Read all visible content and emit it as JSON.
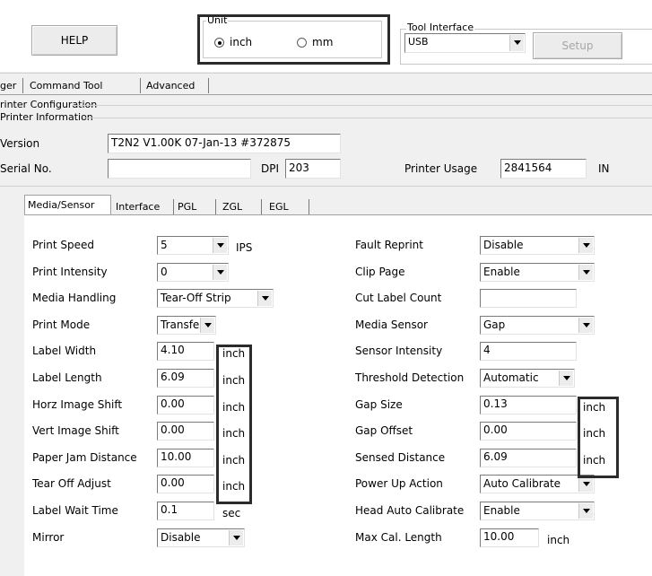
{
  "toolbar": {
    "help_label": "HELP",
    "setup_label": "Setup"
  },
  "unit": {
    "group_label": "Unit",
    "option_inch": "inch",
    "option_mm": "mm",
    "selected": "inch"
  },
  "tool_interface": {
    "group_label": "Tool Interface",
    "value": "USB"
  },
  "main_tabs": [
    "ger",
    "Command Tool",
    "Advanced"
  ],
  "printer_configuration": {
    "label": "rinter Configuration",
    "info_label": "Printer Information",
    "version_label": "Version",
    "version_value": "T2N2 V1.00K 07-Jan-13 #372875",
    "serial_label": "Serial No.",
    "serial_value": "",
    "dpi_label": "DPI",
    "dpi_value": "203",
    "usage_label": "Printer Usage",
    "usage_value": "2841564",
    "usage_unit": "IN"
  },
  "sub_tabs": [
    "Media/Sensor",
    "Interface",
    "PGL",
    "ZGL",
    "EGL"
  ],
  "left_settings": [
    {
      "label": "Print Speed",
      "value": "5",
      "kind": "combo",
      "unit": "IPS"
    },
    {
      "label": "Print Intensity",
      "value": "0",
      "kind": "combo",
      "unit": ""
    },
    {
      "label": "Media Handling",
      "value": "Tear-Off Strip",
      "kind": "combo",
      "unit": ""
    },
    {
      "label": "Print Mode",
      "value": "Transfer",
      "kind": "combo",
      "unit": ""
    },
    {
      "label": "Label Width",
      "value": "4.10",
      "kind": "field",
      "unit": "inch"
    },
    {
      "label": "Label Length",
      "value": "6.09",
      "kind": "field",
      "unit": "inch"
    },
    {
      "label": "Horz Image Shift",
      "value": "0.00",
      "kind": "field",
      "unit": "inch"
    },
    {
      "label": "Vert Image Shift",
      "value": "0.00",
      "kind": "field",
      "unit": "inch"
    },
    {
      "label": "Paper Jam Distance",
      "value": "10.00",
      "kind": "field",
      "unit": "inch"
    },
    {
      "label": "Tear Off Adjust",
      "value": "0.00",
      "kind": "field",
      "unit": "inch"
    },
    {
      "label": "Label Wait Time",
      "value": "0.1",
      "kind": "field",
      "unit": "sec"
    },
    {
      "label": "Mirror",
      "value": "Disable",
      "kind": "combo",
      "unit": ""
    }
  ],
  "right_settings": [
    {
      "label": "Fault Reprint",
      "value": "Disable",
      "kind": "combo",
      "unit": ""
    },
    {
      "label": "Clip Page",
      "value": "Enable",
      "kind": "combo",
      "unit": ""
    },
    {
      "label": "Cut Label Count",
      "value": "",
      "kind": "field",
      "unit": ""
    },
    {
      "label": "Media Sensor",
      "value": "Gap",
      "kind": "combo",
      "unit": ""
    },
    {
      "label": "Sensor Intensity",
      "value": "4",
      "kind": "field",
      "unit": ""
    },
    {
      "label": "Threshold Detection",
      "value": "Automatic",
      "kind": "combo",
      "unit": ""
    },
    {
      "label": "Gap Size",
      "value": "0.13",
      "kind": "field",
      "unit": "inch"
    },
    {
      "label": "Gap Offset",
      "value": "0.00",
      "kind": "field",
      "unit": "inch"
    },
    {
      "label": "Sensed Distance",
      "value": "6.09",
      "kind": "field",
      "unit": "inch"
    },
    {
      "label": "Power Up Action",
      "value": "Auto Calibrate",
      "kind": "combo",
      "unit": ""
    },
    {
      "label": "Head Auto Calibrate",
      "value": "Enable",
      "kind": "combo",
      "unit": ""
    },
    {
      "label": "Max Cal. Length",
      "value": "10.00",
      "kind": "field",
      "unit": "inch"
    }
  ]
}
